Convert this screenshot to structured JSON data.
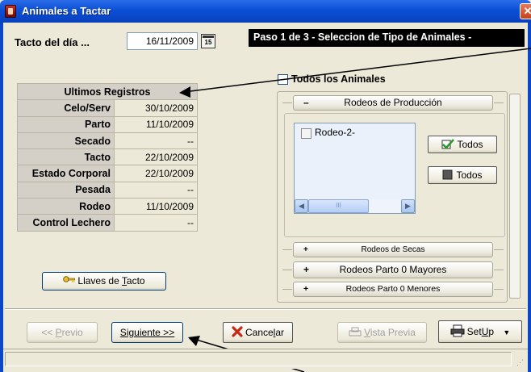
{
  "window": {
    "title": "Animales a Tactar",
    "close_glyph": "✕"
  },
  "header": {
    "tacto_label": "Tacto del día ...",
    "tacto_date": "16/11/2009",
    "calendar_glyph": "15",
    "step_banner": "Paso 1 de 3  - Seleccion de Tipo de Animales -"
  },
  "records": {
    "header": "Ultimos Registros",
    "rows": [
      {
        "label": "Celo/Serv",
        "value": "30/10/2009"
      },
      {
        "label": "Parto",
        "value": "11/10/2009"
      },
      {
        "label": "Secado",
        "value": "--"
      },
      {
        "label": "Tacto",
        "value": "22/10/2009"
      },
      {
        "label": "Estado Corporal",
        "value": "22/10/2009"
      },
      {
        "label": "Pesada",
        "value": "--"
      },
      {
        "label": "Rodeo",
        "value": "11/10/2009"
      },
      {
        "label": "Control Lechero",
        "value": "--"
      }
    ]
  },
  "keys_button": {
    "pre": "Llaves de ",
    "u": "T",
    "post": "acto",
    "icon": "key-icon"
  },
  "animals": {
    "all_label": "Todos los Animales",
    "all_checked": false,
    "production": {
      "sign": "–",
      "label": "Rodeos de Producción",
      "items": [
        {
          "label": "Rodeo-2-",
          "checked": false
        }
      ],
      "check_all_label": "Todos",
      "uncheck_all_label": "Todos",
      "scroll_thumb": "III"
    },
    "sections": [
      {
        "sign": "+",
        "label": "Rodeos de Secas"
      },
      {
        "sign": "+",
        "label": "Rodeos Parto 0 Mayores"
      },
      {
        "sign": "+",
        "label": "Rodeos Parto 0 Menores"
      }
    ]
  },
  "footer": {
    "prev": {
      "pre": "<< ",
      "u": "P",
      "post": "revio"
    },
    "next": {
      "pre": "",
      "u": "S",
      "post": "iguiente >>"
    },
    "cancel": {
      "pre": "Cance",
      "u": "l",
      "post": "ar"
    },
    "preview": {
      "pre": "",
      "u": "V",
      "post": "ista Previa"
    },
    "setup": {
      "pre": "Set",
      "u": "U",
      "post": "p"
    }
  },
  "colors": {
    "titlebar": "#0a46c7",
    "face": "#ece9d8",
    "banner_bg": "#000000",
    "cancel_x": "#c82814"
  }
}
